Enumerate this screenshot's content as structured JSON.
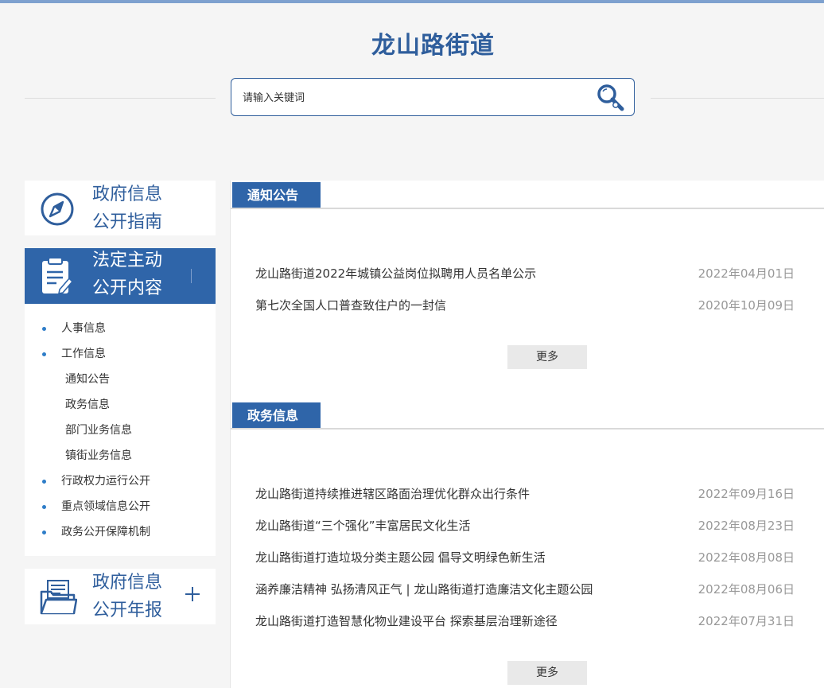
{
  "header": {
    "site_title": "龙山路街道",
    "search_placeholder": "请输入关键词"
  },
  "sidebar": {
    "guide_card": {
      "line1": "政府信息",
      "line2": "公开指南",
      "icon": "compass-icon"
    },
    "statutory_card": {
      "line1": "法定主动",
      "line2": "公开内容",
      "icon": "clipboard-icon"
    },
    "menu": [
      {
        "label": "人事信息",
        "type": "item"
      },
      {
        "label": "工作信息",
        "type": "item"
      },
      {
        "label": "通知公告",
        "type": "sub"
      },
      {
        "label": "政务信息",
        "type": "sub"
      },
      {
        "label": "部门业务信息",
        "type": "sub"
      },
      {
        "label": "镇街业务信息",
        "type": "sub"
      },
      {
        "label": "行政权力运行公开",
        "type": "item"
      },
      {
        "label": "重点领域信息公开",
        "type": "item"
      },
      {
        "label": "政务公开保障机制",
        "type": "item"
      }
    ],
    "annual_card": {
      "line1": "政府信息",
      "line2": "公开年报",
      "icon": "folder-documents-icon",
      "expand_icon": "plus-icon"
    }
  },
  "main": {
    "notices": {
      "tab_label": "通知公告",
      "items": [
        {
          "title": "龙山路街道2022年城镇公益岗位拟聘用人员名单公示",
          "date": "2022年04月01日"
        },
        {
          "title": "第七次全国人口普查致住户的一封信",
          "date": "2020年10月09日"
        }
      ],
      "more_label": "更多"
    },
    "affairs": {
      "tab_label": "政务信息",
      "items": [
        {
          "title": "龙山路街道持续推进辖区路面治理优化群众出行条件",
          "date": "2022年09月16日"
        },
        {
          "title": "龙山路街道“三个强化”丰富居民文化生活",
          "date": "2022年08月23日"
        },
        {
          "title": "龙山路街道打造垃圾分类主题公园 倡导文明绿色新生活",
          "date": "2022年08月08日"
        },
        {
          "title": "涵养廉洁精神 弘扬清风正气 | 龙山路街道打造廉洁文化主题公园",
          "date": "2022年08月06日"
        },
        {
          "title": "龙山路街道打造智慧化物业建设平台 探索基层治理新途径",
          "date": "2022年07月31日"
        }
      ],
      "more_label": "更多"
    }
  },
  "colors": {
    "brand_blue": "#2f65a9",
    "title_blue": "#2f5e9c",
    "bullet_blue": "#2e7dc8",
    "date_gray": "#999999"
  }
}
